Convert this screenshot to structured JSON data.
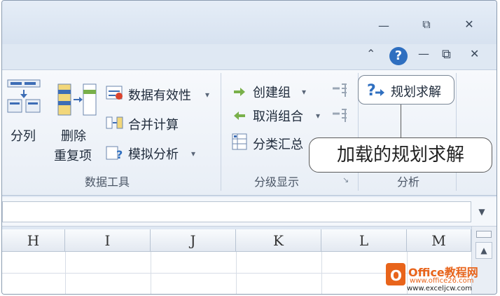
{
  "window_controls": {
    "minimize_icon": "—",
    "restore_icon": "⧉",
    "close_icon": "✕"
  },
  "ribbon_controls": {
    "collapse_icon": "⌃",
    "help_icon": "?",
    "minimize_icon": "—",
    "restore_icon": "⧉",
    "close_icon": "✕"
  },
  "ribbon": {
    "data_tools": {
      "text_to_columns": "分列",
      "remove_duplicates_line1": "删除",
      "remove_duplicates_line2": "重复项",
      "data_validation": "数据有效性",
      "consolidate": "合并计算",
      "what_if": "模拟分析",
      "group_label": "数据工具"
    },
    "outline": {
      "group": "创建组",
      "ungroup": "取消组合",
      "subtotal": "分类汇总",
      "group_label": "分级显示",
      "launcher_icon": "↘"
    },
    "analysis": {
      "solver": "规划求解",
      "group_label": "分析"
    }
  },
  "callout": {
    "text": "加载的规划求解"
  },
  "grid": {
    "columns": [
      "H",
      "I",
      "J",
      "K",
      "L",
      "M"
    ]
  },
  "watermark": {
    "brand": "Office教程网",
    "url1": "www.office26.com",
    "url2": "www.exceljcw.com"
  },
  "colors": {
    "accent": "#2f6fc0",
    "ribbon_bg": "#eef3f9",
    "watermark_orange": "#e8641b"
  }
}
